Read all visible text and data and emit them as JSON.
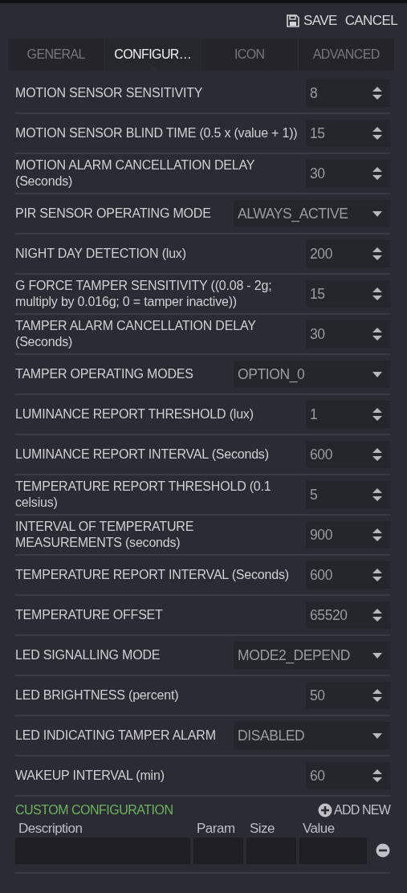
{
  "toolbar": {
    "save": "SAVE",
    "cancel": "CANCEL"
  },
  "tabs": [
    {
      "label": "GENERAL",
      "selected": false
    },
    {
      "label": "CONFIGUR…",
      "selected": true
    },
    {
      "label": "ICON",
      "selected": false
    },
    {
      "label": "ADVANCED",
      "selected": false
    }
  ],
  "settings": [
    {
      "kind": "number",
      "label": "MOTION SENSOR SENSITIVITY",
      "value": "8"
    },
    {
      "kind": "number",
      "label": "MOTION SENSOR BLIND TIME (0.5 x (value + 1))",
      "value": "15"
    },
    {
      "kind": "number",
      "label": "MOTION ALARM CANCELLATION DELAY (Seconds)",
      "value": "30"
    },
    {
      "kind": "select",
      "label": "PIR SENSOR OPERATING MODE",
      "value": "ALWAYS_ACTIVE"
    },
    {
      "kind": "number",
      "label": "NIGHT DAY DETECTION (lux)",
      "value": "200"
    },
    {
      "kind": "number",
      "label": "G FORCE TAMPER SENSITIVITY ((0.08 - 2g; multiply by 0.016g; 0 = tamper inactive))",
      "value": "15"
    },
    {
      "kind": "number",
      "label": "TAMPER ALARM CANCELLATION DELAY (Seconds)",
      "value": "30"
    },
    {
      "kind": "select",
      "label": "TAMPER OPERATING MODES",
      "value": "OPTION_0"
    },
    {
      "kind": "number",
      "label": "LUMINANCE REPORT THRESHOLD (lux)",
      "value": "1"
    },
    {
      "kind": "number",
      "label": "LUMINANCE REPORT INTERVAL (Seconds)",
      "value": "600"
    },
    {
      "kind": "number",
      "label": "TEMPERATURE REPORT THRESHOLD (0.1 celsius)",
      "value": "5"
    },
    {
      "kind": "number",
      "label": "INTERVAL OF TEMPERATURE MEASUREMENTS (seconds)",
      "value": "900"
    },
    {
      "kind": "number",
      "label": "TEMPERATURE REPORT INTERVAL (Seconds)",
      "value": "600"
    },
    {
      "kind": "number",
      "label": "TEMPERATURE OFFSET",
      "value": "65520"
    },
    {
      "kind": "select",
      "label": "LED SIGNALLING MODE",
      "value": "MODE2_DEPEND"
    },
    {
      "kind": "number",
      "label": "LED BRIGHTNESS (percent)",
      "value": "50"
    },
    {
      "kind": "select",
      "label": "LED INDICATING TAMPER ALARM",
      "value": "DISABLED"
    },
    {
      "kind": "number",
      "label": "WAKEUP INTERVAL (min)",
      "value": "60"
    }
  ],
  "custom_configuration": {
    "title": "CUSTOM CONFIGURATION",
    "add_new": "ADD NEW",
    "columns": [
      "Description",
      "Param",
      "Size",
      "Value"
    ]
  }
}
